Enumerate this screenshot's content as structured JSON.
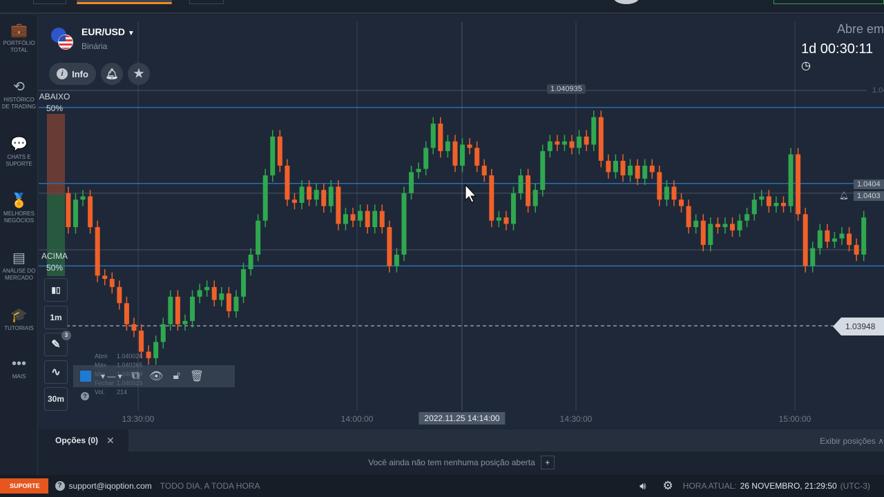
{
  "sidebar": {
    "items": [
      {
        "icon": "briefcase-icon",
        "glyph": "💼",
        "label": "PORTFÓLIO TOTAL"
      },
      {
        "icon": "history-icon",
        "glyph": "⟲",
        "label": "HISTÓRICO DE TRADING"
      },
      {
        "icon": "chat-icon",
        "glyph": "💬",
        "label": "CHATS E SUPORTE"
      },
      {
        "icon": "medal-icon",
        "glyph": "🏅",
        "label": "MELHORES NEGÓCIOS"
      },
      {
        "icon": "news-icon",
        "glyph": "▤",
        "label": "ANÁLISE DO MERCADO"
      },
      {
        "icon": "graduation-cap-icon",
        "glyph": "🎓",
        "label": "TUTORIAIS"
      },
      {
        "icon": "more-icon",
        "glyph": "•••",
        "label": "MAIS"
      }
    ]
  },
  "asset": {
    "name": "EUR/USD",
    "type": "Binária",
    "info_label": "Info"
  },
  "sentiment": {
    "down_label": "ABAIXO",
    "down_pct": "50%",
    "up_label": "ACIMA",
    "up_pct": "50%",
    "down_value": 50,
    "up_value": 50
  },
  "tools": {
    "timeframe": "1m",
    "interval": "30m",
    "drawings_count": "3"
  },
  "ohlc": {
    "labels": [
      "Abrir",
      "Máx",
      "Mín",
      "Fechar",
      "Vol."
    ],
    "values": [
      "1.040026",
      "1.040265",
      "1.040079",
      "1.040515",
      "214"
    ]
  },
  "countdown": {
    "label": "Abre em",
    "value": "1d 00:30:11"
  },
  "price_labels": {
    "top": "1.040935",
    "right_top": "1.04",
    "p1": "1.0404",
    "p2": "1.0403",
    "current": "1.03948"
  },
  "time_axis": {
    "ticks": [
      "13:30:00",
      "14:00:00",
      "14:30:00",
      "15:00:00"
    ],
    "crosshair": "2022.11.25 14:14:00"
  },
  "positions": {
    "tab": "Opções (0)",
    "show": "Exibir posições",
    "empty": "Você ainda não tem nenhuma posição aberta"
  },
  "footer": {
    "support": "SUPORTE",
    "email": "support@iqoption.com",
    "hours": "TODO DIA, A TODA HORA",
    "time_label": "HORA ATUAL:",
    "time_value": "26 NOVEMBRO, 21:29:50",
    "tz": "(UTC-3)"
  },
  "colors": {
    "up": "#2fa84f",
    "down": "#f0612a",
    "hline": "#2a6fb0"
  },
  "chart_data": {
    "type": "candlestick",
    "interval_minutes": 1,
    "first_candle_time": "13:21",
    "first_open": 1.0403,
    "closes": [
      1.04009,
      1.04026,
      1.04028,
      1.04009,
      1.03979,
      1.03977,
      1.03972,
      1.03962,
      1.03949,
      1.03945,
      1.03932,
      1.03928,
      1.03938,
      1.03949,
      1.03966,
      1.03949,
      1.03951,
      1.03966,
      1.0397,
      1.03972,
      1.03964,
      1.03968,
      1.03957,
      1.03966,
      1.03983,
      1.03992,
      1.04013,
      1.04041,
      1.04065,
      1.04047,
      1.04026,
      1.04024,
      1.04034,
      1.04026,
      1.04032,
      1.04022,
      1.04034,
      1.04011,
      1.04017,
      1.04013,
      1.04019,
      1.04009,
      1.04019,
      1.04009,
      1.03985,
      1.03992,
      1.0403,
      1.04043,
      1.04045,
      1.04058,
      1.04073,
      1.04056,
      1.04062,
      1.04047,
      1.0406,
      1.04058,
      1.04047,
      1.04041,
      1.04013,
      1.04015,
      1.04011,
      1.0403,
      1.04041,
      1.04022,
      1.04032,
      1.04056,
      1.04062,
      1.0406,
      1.04062,
      1.04058,
      1.04065,
      1.0406,
      1.04077,
      1.0405,
      1.04043,
      1.0405,
      1.04041,
      1.04047,
      1.04039,
      1.04047,
      1.04043,
      1.04026,
      1.04034,
      1.04026,
      1.04022,
      1.04009,
      1.04013,
      1.03998,
      1.04011,
      1.04009,
      1.04011,
      1.04007,
      1.04013,
      1.04017,
      1.04026,
      1.04028,
      1.04022,
      1.04024,
      1.04022,
      1.04054,
      1.04017,
      1.03985,
      1.03996,
      1.04007,
      1.04,
      1.04002,
      1.04005,
      1.03998,
      1.03992,
      1.04015
    ],
    "blue_levels": [
      1.04083,
      1.04036,
      1.03985
    ],
    "gray_levels": [
      1.040935,
      1.0403,
      1.03995
    ],
    "current_price": 1.03948,
    "ylim": [
      1.0389,
      1.04115
    ],
    "x_ticks": [
      "13:30",
      "14:00",
      "14:30",
      "15:00"
    ],
    "crosshair_time": "14:14"
  }
}
